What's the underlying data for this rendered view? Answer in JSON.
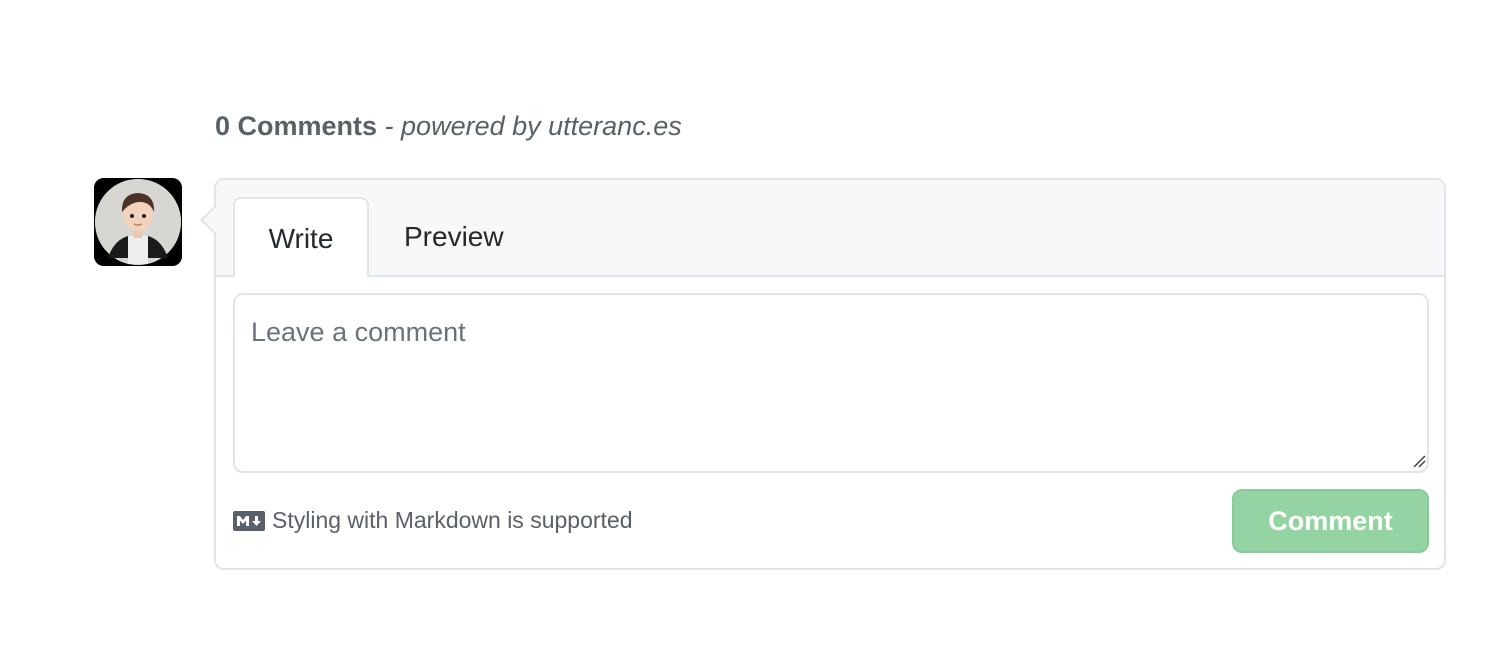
{
  "header": {
    "count_label": "0 Comments",
    "powered_label": " - powered by utteranc.es"
  },
  "avatar": {
    "icon": "user-avatar-memoji"
  },
  "tabs": [
    {
      "label": "Write",
      "selected": true
    },
    {
      "label": "Preview",
      "selected": false
    }
  ],
  "comment": {
    "placeholder": "Leave a comment",
    "value": ""
  },
  "footer": {
    "markdown_hint": "Styling with Markdown is supported",
    "markdown_icon": "markdown-icon",
    "submit_label": "Comment",
    "submit_color": "#94d3a2"
  }
}
